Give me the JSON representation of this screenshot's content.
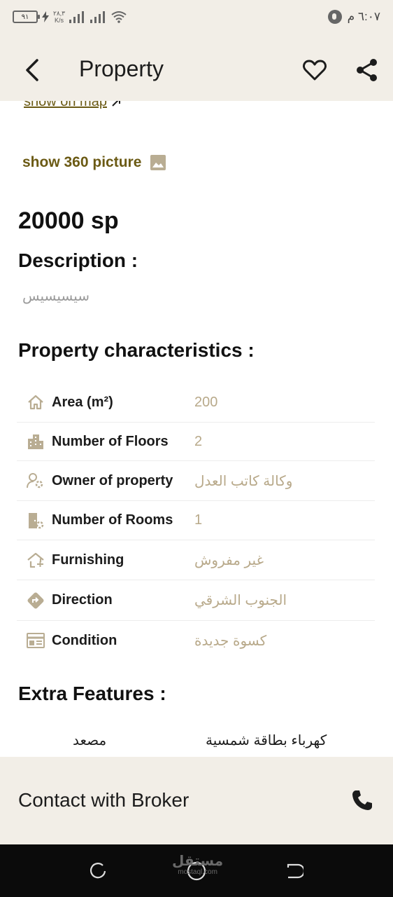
{
  "status_bar": {
    "battery": "٩١",
    "net_speed_value": "٢٨,٣",
    "net_speed_unit": "K/s",
    "time": "٦:٠٧ م"
  },
  "app_bar": {
    "title": "Property"
  },
  "links": {
    "show_on_map": "show on map",
    "show_360": "show 360 picture"
  },
  "price": "20000 sp",
  "description": {
    "heading": "Description :",
    "text": "سيسيسيس"
  },
  "characteristics": {
    "heading": "Property characteristics :",
    "rows": [
      {
        "icon": "home-icon",
        "label": "Area (m²)",
        "value": "200"
      },
      {
        "icon": "building-icon",
        "label": "Number of Floors",
        "value": "2"
      },
      {
        "icon": "user-gear-icon",
        "label": "Owner of property",
        "value": "وكالة كاتب العدل"
      },
      {
        "icon": "door-gear-icon",
        "label": "Number of Rooms",
        "value": "1"
      },
      {
        "icon": "house-outline-icon",
        "label": "Furnishing",
        "value": "غير مفروش"
      },
      {
        "icon": "direction-icon",
        "label": "Direction",
        "value": "الجنوب الشرقي"
      },
      {
        "icon": "condition-icon",
        "label": "Condition",
        "value": "كسوة جديدة"
      }
    ]
  },
  "extra_features": {
    "heading": "Extra Features :",
    "items": [
      "مصعد",
      "كهرباء بطاقة شمسية"
    ]
  },
  "contact": {
    "label": "Contact with Broker"
  },
  "watermark": {
    "name": "مستقل",
    "domain": "mostaql.com"
  },
  "colors": {
    "header_bg": "#f2eee7",
    "link": "#6b5a14",
    "value": "#b8a98a",
    "icon": "#b9ad93"
  }
}
